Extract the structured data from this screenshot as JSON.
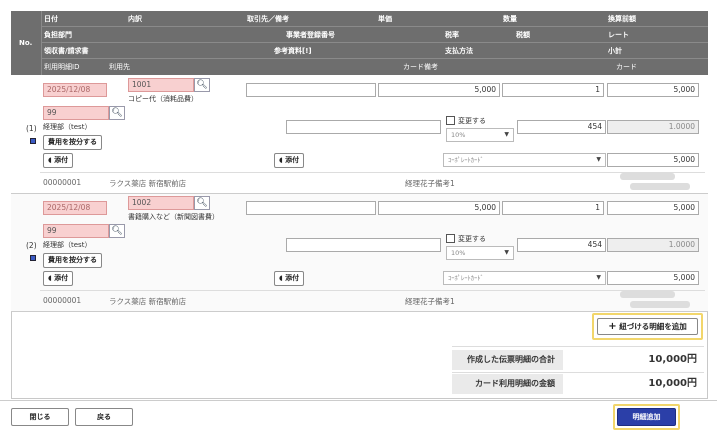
{
  "header": {
    "no": "No.",
    "row1": [
      "日付",
      "内訳",
      "取引先／備考",
      "単価",
      "数量",
      "換算前額"
    ],
    "row2": [
      "負担部門",
      "事業者登録番号",
      "税率",
      "税額",
      "レート"
    ],
    "row3": [
      "領収書/請求書",
      "参考資料[!]",
      "支払方法",
      "小計"
    ],
    "row4": [
      "利用明細ID",
      "利用先",
      "カード備考",
      "カード"
    ]
  },
  "entries": [
    {
      "index": "(1)",
      "date": "2025/12/08",
      "item_code": "1001",
      "item_name": "コピー代（消耗品費）",
      "unit_price": "5,000",
      "quantity": "1",
      "amount": "5,000",
      "dept_code": "99",
      "dept_name": "経理部（test）",
      "allocate_label": "費用を按分する",
      "change_label": "変更する",
      "tax_rate": "10%",
      "tax_amount": "454",
      "rate": "1.0000",
      "attach_label": "添付",
      "ref_attach_label": "添付",
      "payment": "ｺｰﾎﾟﾚｰﾄｶｰﾄﾞ",
      "subtotal": "5,000",
      "usage_id": "00000001",
      "usage_place": "ラクス薬店 新宿駅前店",
      "card_note": "経理花子備考1"
    },
    {
      "index": "(2)",
      "date": "2025/12/08",
      "item_code": "1002",
      "item_name": "書籍購入など（新聞図書費）",
      "unit_price": "5,000",
      "quantity": "1",
      "amount": "5,000",
      "dept_code": "99",
      "dept_name": "経理部（test）",
      "allocate_label": "費用を按分する",
      "change_label": "変更する",
      "tax_rate": "10%",
      "tax_amount": "454",
      "rate": "1.0000",
      "attach_label": "添付",
      "ref_attach_label": "添付",
      "payment": "ｺｰﾎﾟﾚｰﾄｶｰﾄﾞ",
      "subtotal": "5,000",
      "usage_id": "00000001",
      "usage_place": "ラクス薬店 新宿駅前店",
      "card_note": "経理花子備考1"
    }
  ],
  "add_linked_label": "紐づける明細を追加",
  "summary": {
    "created_total_label": "作成した伝票明細の合計",
    "created_total_value": "10,000円",
    "card_total_label": "カード利用明細の金額",
    "card_total_value": "10,000円"
  },
  "footer": {
    "close_label": "閉じる",
    "back_label": "戻る",
    "add_detail_label": "明細追加"
  },
  "colors": {
    "header_bg": "#6e6e6e",
    "required_field": "#f8d0d0",
    "highlight": "#f2d66b",
    "primary_button": "#2b3fa8"
  }
}
